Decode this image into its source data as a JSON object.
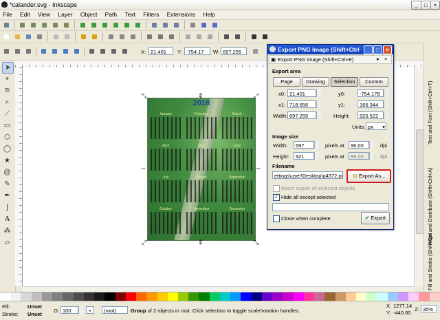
{
  "window": {
    "title": "*calander.svg - Inkscape"
  },
  "menu": [
    "File",
    "Edit",
    "View",
    "Layer",
    "Object",
    "Path",
    "Text",
    "Filters",
    "Extensions",
    "Help"
  ],
  "coords": {
    "x_label": "X:",
    "x_value": "21.401",
    "y_label": "Y:",
    "y_value": "-754.17",
    "w_label": "W:",
    "w_value": "697.255"
  },
  "docks": [
    "Text and Font (Shift+Ctrl+T)",
    "Align and Distribute (Shift+Ctrl+A)",
    "Fill and Stroke (Shift+Ctrl+F)"
  ],
  "calendar": {
    "year": "2018",
    "months": [
      "January",
      "February",
      "March",
      "April",
      "May",
      "June",
      "July",
      "August",
      "September",
      "October",
      "November",
      "December"
    ]
  },
  "dialog": {
    "title": "Export PNG Image (Shift+Ctrl+...",
    "subtitle": "Export PNG Image (Shift+Ctrl+E)",
    "export_area": "Export area",
    "area_buttons": [
      "Page",
      "Drawing",
      "Selection",
      "Custom"
    ],
    "x0_label": "x0:",
    "x0": "21.401",
    "y0_label": "y0:",
    "y0": "-754.178",
    "x1_label": "x1:",
    "x1": "718.656",
    "y1_label": "y1:",
    "y1": "166.344",
    "width_label": "Width:",
    "width": "697.255",
    "height_label": "Height:",
    "height": "920.522",
    "units_label": "Units:",
    "units": "px",
    "image_size": "Image size",
    "img_width_label": "Width:",
    "img_width": "697",
    "img_height_label": "Height:",
    "img_height": "921",
    "pixels_at": "pixels at",
    "dpi_value": "96.00",
    "dpi": "dpi",
    "filename_label": "Filename",
    "filename": "ettings\\user\\Desktop\\g4372.png",
    "export_as": "Export As...",
    "batch_export": "Batch export all selected objects",
    "hide_all": "Hide all except selected",
    "close_when_complete": "Close when complete",
    "export": "Export"
  },
  "status": {
    "fill_label": "Fill:",
    "fill_value": "Unset",
    "stroke_label": "Stroke:",
    "stroke_value": "Unset",
    "opacity_label": "O:",
    "opacity": "100",
    "layer": "(root)",
    "message_bold": "Group",
    "message": " of 2 objects in root. Click selection to toggle scale/rotation handles.",
    "cursor_x_label": "X:",
    "cursor_x": "1277.14",
    "cursor_y_label": "Y:",
    "cursor_y": "-440.00",
    "zoom_label": "Z:",
    "zoom": "35%"
  },
  "palette_colors": [
    "#ffffff",
    "#f2f2f2",
    "#d9d9d9",
    "#bfbfbf",
    "#999999",
    "#808080",
    "#666666",
    "#4d4d4d",
    "#333333",
    "#1a1a1a",
    "#000000",
    "#800000",
    "#ff0000",
    "#ff6600",
    "#ff9900",
    "#ffcc00",
    "#ffff00",
    "#99cc00",
    "#339900",
    "#008000",
    "#00cc66",
    "#00cccc",
    "#0099ff",
    "#0000ff",
    "#000080",
    "#6600cc",
    "#9900cc",
    "#cc00cc",
    "#ff00ff",
    "#ff3399",
    "#cc6699",
    "#996633",
    "#cc9966",
    "#ffcc99",
    "#ffffcc",
    "#ccffcc",
    "#ccffff",
    "#99ccff",
    "#cc99ff",
    "#ffccff",
    "#ff9999",
    "#ffcccc"
  ]
}
